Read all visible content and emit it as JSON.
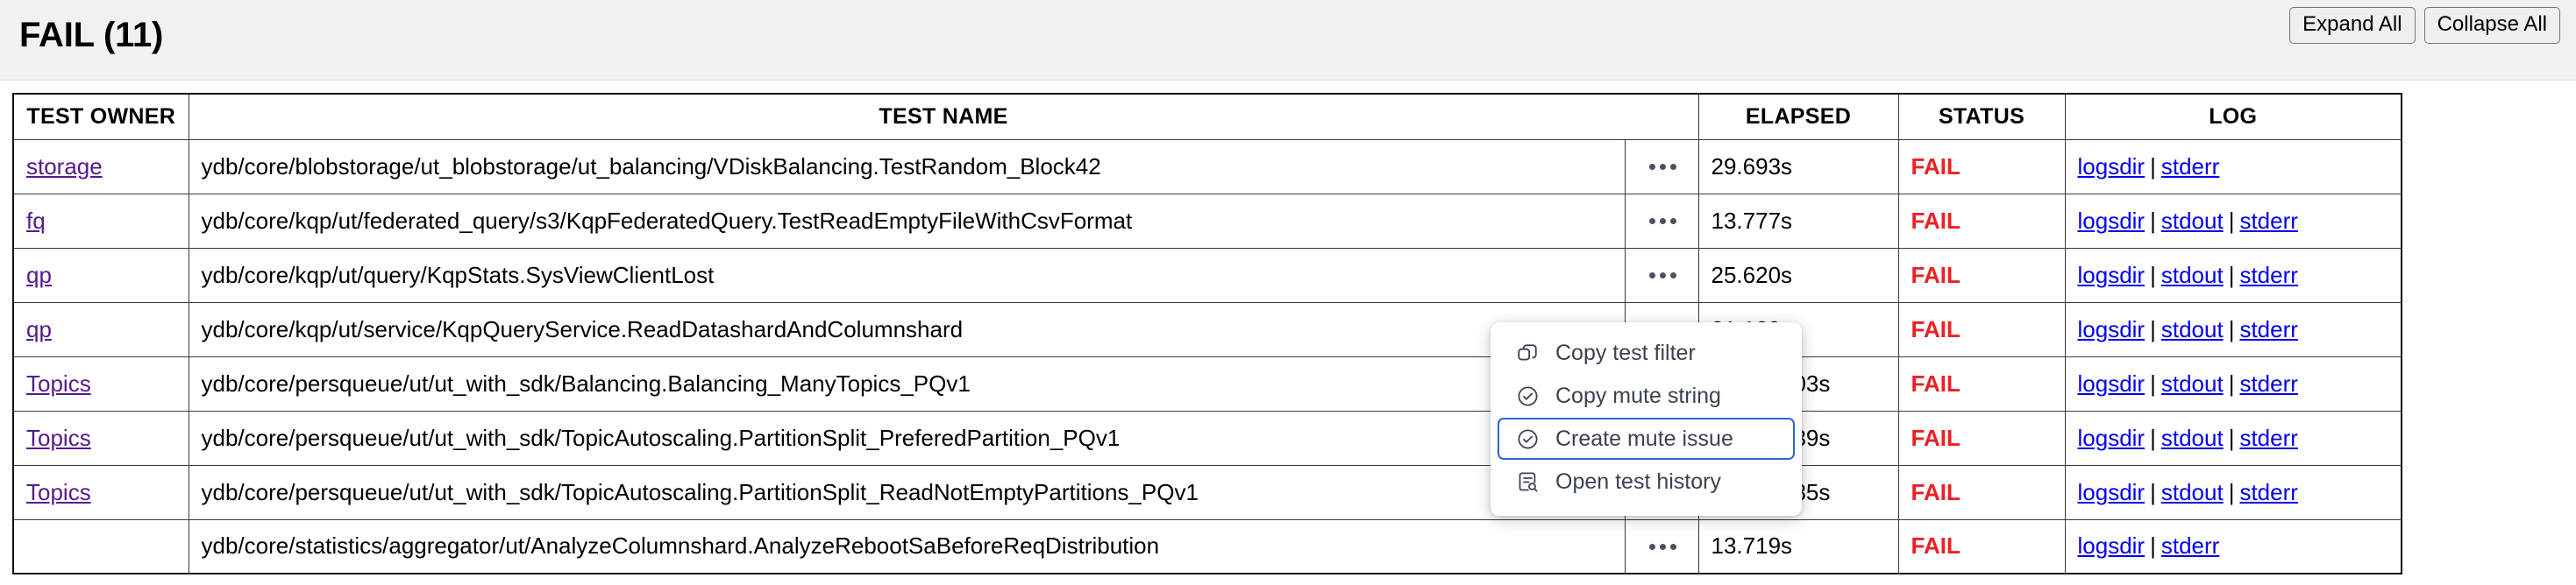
{
  "header": {
    "title": "FAIL (11)",
    "expand_all_label": "Expand All",
    "collapse_all_label": "Collapse All"
  },
  "table": {
    "columns": {
      "owner": "TEST OWNER",
      "name": "TEST NAME",
      "elapsed": "ELAPSED",
      "status": "STATUS",
      "log": "LOG"
    },
    "rows": [
      {
        "owner": "storage",
        "name": "ydb/core/blobstorage/ut_blobstorage/ut_balancing/VDiskBalancing.TestRandom_Block42",
        "elapsed": "29.693s",
        "status": "FAIL",
        "logs": [
          "logsdir",
          "stderr"
        ]
      },
      {
        "owner": "fq",
        "name": "ydb/core/kqp/ut/federated_query/s3/KqpFederatedQuery.TestReadEmptyFileWithCsvFormat",
        "elapsed": "13.777s",
        "status": "FAIL",
        "logs": [
          "logsdir",
          "stdout",
          "stderr"
        ]
      },
      {
        "owner": "qp",
        "name": "ydb/core/kqp/ut/query/KqpStats.SysViewClientLost",
        "elapsed": "25.620s",
        "status": "FAIL",
        "logs": [
          "logsdir",
          "stdout",
          "stderr"
        ]
      },
      {
        "owner": "qp",
        "name": "ydb/core/kqp/ut/service/KqpQueryService.ReadDatashardAndColumnshard",
        "elapsed": "21.129s",
        "status": "FAIL",
        "logs": [
          "logsdir",
          "stdout",
          "stderr"
        ]
      },
      {
        "owner": "Topics",
        "name": "ydb/core/persqueue/ut/ut_with_sdk/Balancing.Balancing_ManyTopics_PQv1",
        "elapsed": "9m 35.103s",
        "status": "FAIL",
        "logs": [
          "logsdir",
          "stdout",
          "stderr"
        ]
      },
      {
        "owner": "Topics",
        "name": "ydb/core/persqueue/ut/ut_with_sdk/TopicAutoscaling.PartitionSplit_PreferedPartition_PQv1",
        "elapsed": "9m 24.339s",
        "status": "FAIL",
        "logs": [
          "logsdir",
          "stdout",
          "stderr"
        ]
      },
      {
        "owner": "Topics",
        "name": "ydb/core/persqueue/ut/ut_with_sdk/TopicAutoscaling.PartitionSplit_ReadNotEmptyPartitions_PQv1",
        "elapsed": "9m 26.385s",
        "status": "FAIL",
        "logs": [
          "logsdir",
          "stdout",
          "stderr"
        ]
      },
      {
        "owner": "",
        "name": "ydb/core/statistics/aggregator/ut/AnalyzeColumnshard.AnalyzeRebootSaBeforeReqDistribution",
        "elapsed": "13.719s",
        "status": "FAIL",
        "logs": [
          "logsdir",
          "stderr"
        ]
      }
    ]
  },
  "context_menu": {
    "items": [
      {
        "label": "Copy test filter",
        "icon": "copy-icon",
        "selected": false
      },
      {
        "label": "Copy mute string",
        "icon": "check-circle-icon",
        "selected": false
      },
      {
        "label": "Create mute issue",
        "icon": "check-circle-icon",
        "selected": true
      },
      {
        "label": "Open test history",
        "icon": "document-search-icon",
        "selected": false
      }
    ]
  },
  "colors": {
    "fail": "#ec2024",
    "log_link": "#0000ee",
    "owner_link": "#551a8b",
    "menu_focus": "#2f66d0",
    "header_bg": "#f1f1f1"
  },
  "icons": {
    "dots": "ellipsis-horizontal-icon"
  }
}
